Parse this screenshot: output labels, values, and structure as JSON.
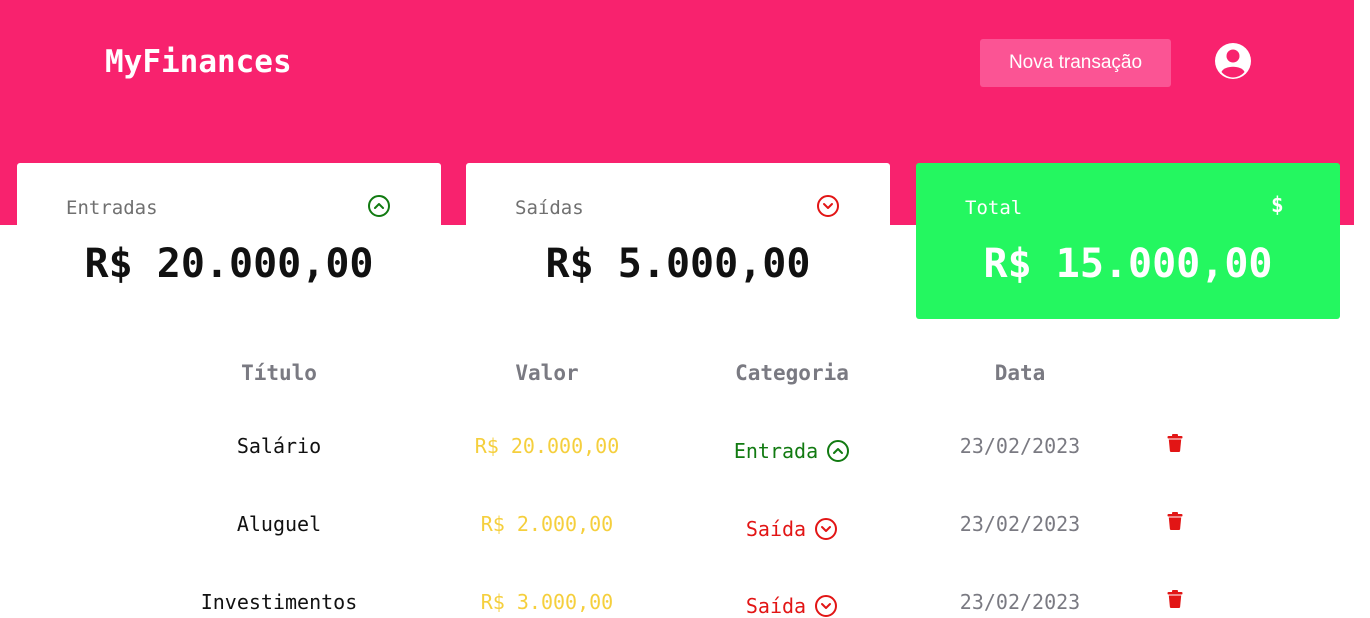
{
  "header": {
    "logo": "MyFinances",
    "new_transaction_label": "Nova transação",
    "user_icon": "user-circle-icon",
    "color": "#f8226e"
  },
  "summary": {
    "income": {
      "label": "Entradas",
      "value": "R$ 20.000,00",
      "icon": "arrow-up-circle-icon"
    },
    "outcome": {
      "label": "Saídas",
      "value": "R$ 5.000,00",
      "icon": "arrow-down-circle-icon"
    },
    "total": {
      "label": "Total",
      "value": "R$ 15.000,00",
      "icon": "$",
      "color": "#24f760"
    }
  },
  "table": {
    "headers": [
      "Título",
      "Valor",
      "Categoria",
      "Data"
    ],
    "rows": [
      {
        "title": "Salário",
        "value": "R$ 20.000,00",
        "category": "Entrada",
        "type": "income",
        "date": "23/02/2023"
      },
      {
        "title": "Aluguel",
        "value": "R$ 2.000,00",
        "category": "Saída",
        "type": "outcome",
        "date": "23/02/2023"
      },
      {
        "title": "Investimentos",
        "value": "R$ 3.000,00",
        "category": "Saída",
        "type": "outcome",
        "date": "23/02/2023"
      }
    ]
  }
}
